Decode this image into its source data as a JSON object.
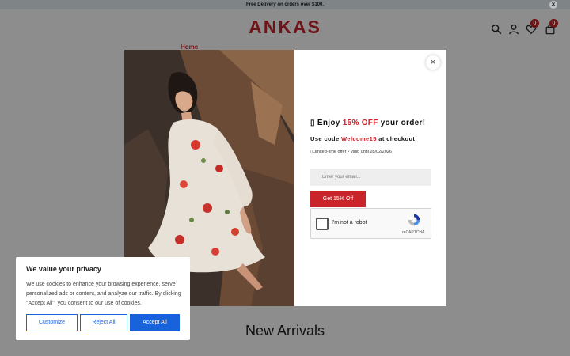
{
  "announcement": {
    "text": "Free Delivery on orders over $100.",
    "close": "×"
  },
  "header": {
    "logo": "ANKAS",
    "wishlist_count": "0",
    "cart_count": "0",
    "icons": [
      "search-icon",
      "user-icon",
      "heart-icon",
      "bag-icon"
    ]
  },
  "breadcrumb": {
    "home": "Home"
  },
  "section": {
    "new_arrivals": "New Arrivals"
  },
  "popup": {
    "close": "×",
    "offer_prefix": "Enjoy ",
    "offer_highlight": "15% OFF",
    "offer_suffix": " your order!",
    "code_prefix": "Use code ",
    "code_value": "Welcome15",
    "code_suffix": " at checkout",
    "validity": "Limited-time offer • Valid until 28/02/2026",
    "email_placeholder": "Enter your email...",
    "cta_label": "Get 15% Off",
    "captcha_label": "I'm not a robot",
    "captcha_brand": "reCAPTCHA"
  },
  "cookie_banner": {
    "title": "We value your privacy",
    "text": "We use cookies to enhance your browsing experience, serve personalized ads or content, and analyze our traffic. By clicking \"Accept All\", you consent to our use of cookies.",
    "customize": "Customize",
    "reject": "Reject All",
    "accept": "Accept All"
  },
  "colors": {
    "brand": "#6e1318",
    "accent_red": "#c9242a",
    "cookie_blue": "#1863dc"
  }
}
